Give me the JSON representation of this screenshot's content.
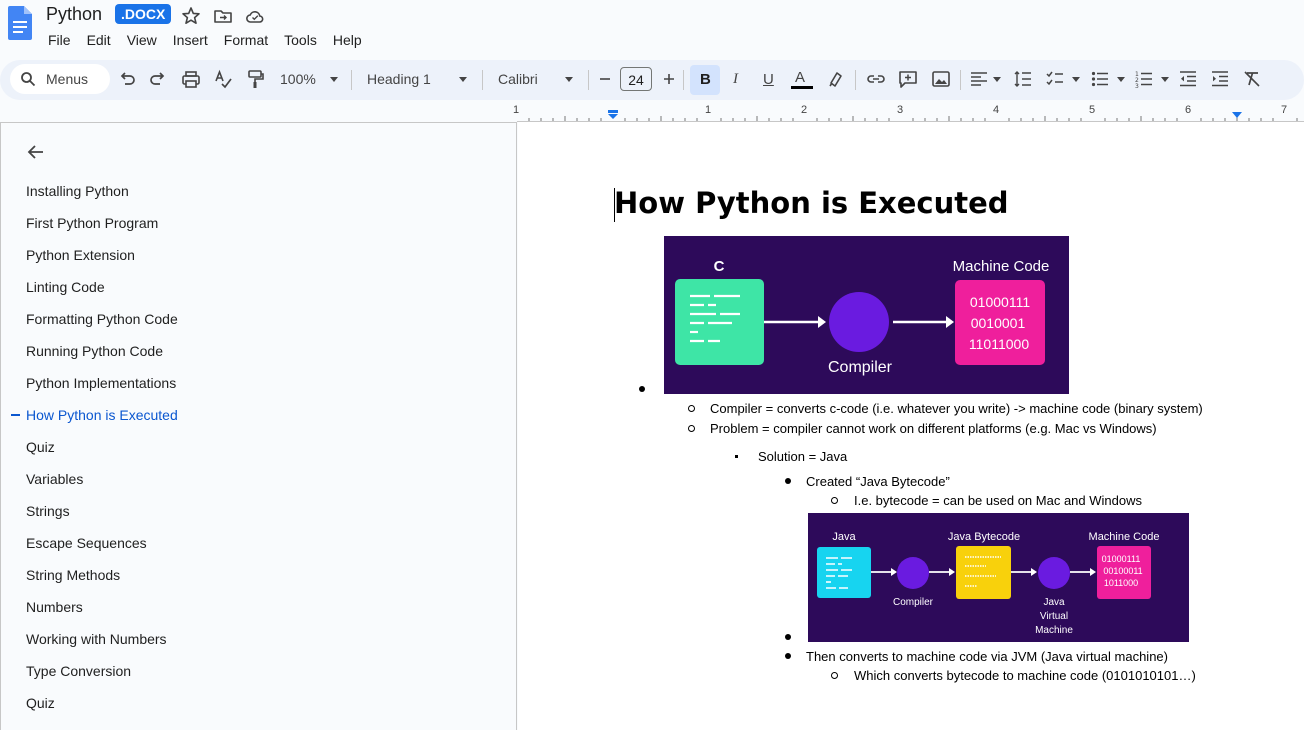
{
  "titlebar": {
    "doc_title": "Python",
    "badge": ".DOCX",
    "icons": [
      "star-icon",
      "move-to-folder-icon",
      "cloud-status-icon"
    ]
  },
  "menubar": {
    "items": [
      "File",
      "Edit",
      "View",
      "Insert",
      "Format",
      "Tools",
      "Help"
    ]
  },
  "toolbar": {
    "search_label": "Menus",
    "zoom": "100%",
    "style": "Heading 1",
    "font": "Calibri",
    "font_size": "24",
    "bold": "B",
    "italic": "I",
    "underline": "U",
    "text_color_letter": "A"
  },
  "ruler": {
    "numbers": [
      "1",
      "1",
      "2",
      "3",
      "4",
      "5",
      "6",
      "7"
    ]
  },
  "outline": {
    "items": [
      "Installing Python",
      "First Python Program",
      "Python Extension",
      "Linting Code",
      "Formatting Python Code",
      "Running Python Code",
      "Python Implementations",
      "How Python is Executed",
      "Quiz",
      "Variables",
      "Strings",
      "Escape Sequences",
      "String Methods",
      "Numbers",
      "Working with Numbers",
      "Type Conversion",
      "Quiz"
    ],
    "active_index": 7
  },
  "document": {
    "heading": "How Python is Executed",
    "diagram1": {
      "left_label": "C",
      "right_label": "Machine Code",
      "middle_label": "Compiler",
      "binary": [
        "01000111",
        "0010001",
        "11011000"
      ]
    },
    "lines": {
      "compiler": "Compiler = converts c-code (i.e. whatever you write) -> machine code (binary system)",
      "problem": "Problem = compiler cannot work on different platforms (e.g. Mac vs Windows)",
      "solution": "Solution = Java",
      "created": "Created “Java Bytecode”",
      "ie": "I.e. bytecode = can be used on Mac and Windows",
      "then": "Then converts to machine code via JVM (Java virtual machine)",
      "which": "Which converts bytecode to machine code (0101010101…)"
    },
    "diagram2": {
      "java": "Java",
      "bytecode": "Java Bytecode",
      "machine": "Machine Code",
      "compiler": "Compiler",
      "jvm": [
        "Java",
        "Virtual",
        "Machine"
      ],
      "binary": [
        "01000111",
        "00100011",
        "1011000"
      ]
    }
  },
  "colors": {
    "accent": "#1a73e8",
    "active_outline": "#0b57d0",
    "diagram_bg": "#2d0a5a",
    "purple_circle": "#6a1be0",
    "green_box": "#3ee5a6",
    "pink_box": "#ef1f9c",
    "cyan_box": "#17d4f0",
    "yellow_box": "#f8d10c"
  }
}
